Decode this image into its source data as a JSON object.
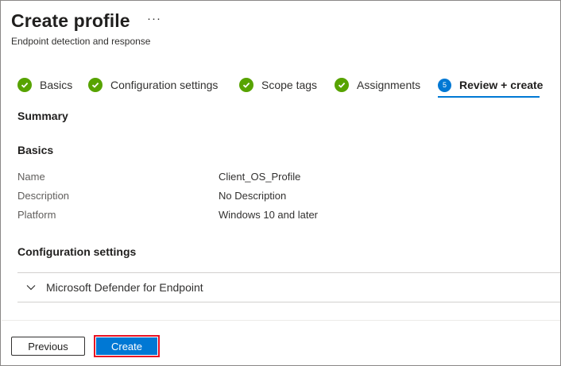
{
  "header": {
    "title": "Create profile",
    "more_label": "···",
    "subtitle": "Endpoint detection and response"
  },
  "tabs": [
    {
      "label": "Basics",
      "state": "complete"
    },
    {
      "label": "Configuration settings",
      "state": "complete"
    },
    {
      "label": "Scope tags",
      "state": "complete"
    },
    {
      "label": "Assignments",
      "state": "complete"
    },
    {
      "label": "Review + create",
      "state": "active",
      "step": "5"
    }
  ],
  "summary": {
    "heading": "Summary",
    "basics_heading": "Basics",
    "rows": [
      {
        "label": "Name",
        "value": "Client_OS_Profile"
      },
      {
        "label": "Description",
        "value": "No Description"
      },
      {
        "label": "Platform",
        "value": "Windows 10 and later"
      }
    ],
    "config_heading": "Configuration settings",
    "accordion_label": "Microsoft Defender for Endpoint"
  },
  "footer": {
    "previous_label": "Previous",
    "create_label": "Create"
  },
  "colors": {
    "accent": "#0078d4",
    "success": "#57a300",
    "highlight": "#e81123"
  }
}
